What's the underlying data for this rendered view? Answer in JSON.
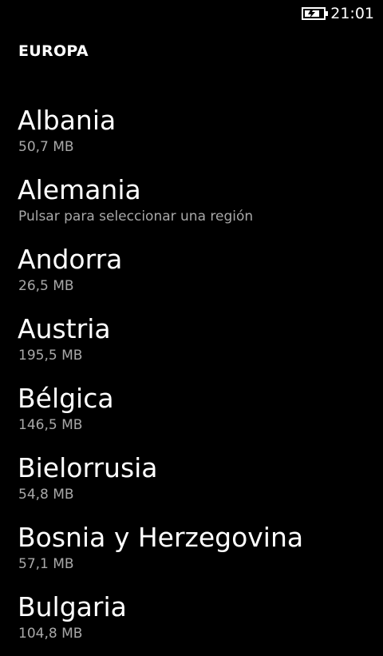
{
  "status_bar": {
    "battery_icon": "battery-charging-icon",
    "time": "21:01"
  },
  "page": {
    "title": "EUROPA"
  },
  "colors": {
    "background": "#000000",
    "title_text": "#ffffff",
    "secondary_text": "#a8a8a8"
  },
  "countries": [
    {
      "name": "Albania",
      "detail": "50,7 MB"
    },
    {
      "name": "Alemania",
      "detail": "Pulsar para seleccionar una región"
    },
    {
      "name": "Andorra",
      "detail": "26,5 MB"
    },
    {
      "name": "Austria",
      "detail": "195,5 MB"
    },
    {
      "name": "Bélgica",
      "detail": "146,5 MB"
    },
    {
      "name": "Bielorrusia",
      "detail": "54,8 MB"
    },
    {
      "name": "Bosnia y Herzegovina",
      "detail": "57,1 MB"
    },
    {
      "name": "Bulgaria",
      "detail": "104,8 MB"
    }
  ]
}
